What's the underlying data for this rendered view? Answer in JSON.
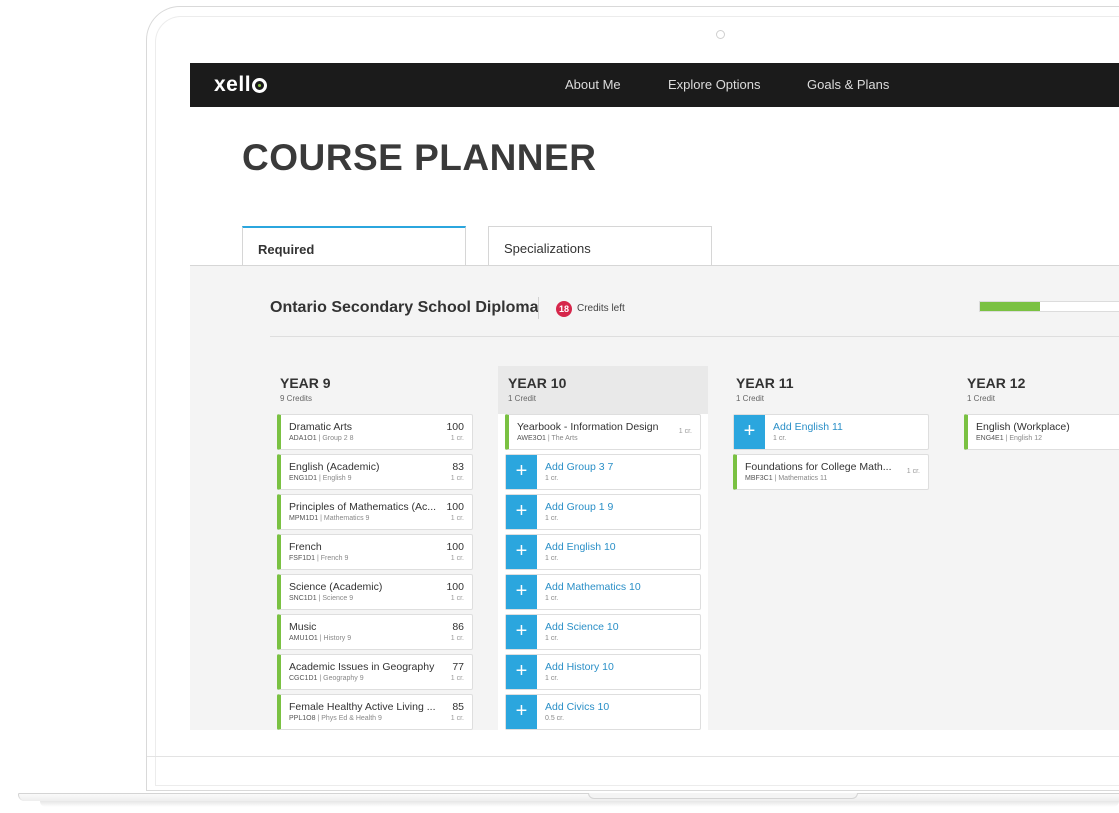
{
  "nav": {
    "logo": "xello",
    "items": [
      "About Me",
      "Explore Options",
      "Goals & Plans"
    ]
  },
  "page": {
    "title": "COURSE PLANNER"
  },
  "tabs": [
    {
      "label": "Required",
      "active": true
    },
    {
      "label": "Specializations",
      "active": false
    }
  ],
  "diploma": {
    "name": "Ontario Secondary School Diploma",
    "credits_left": "18",
    "credits_left_label": "Credits left",
    "progress_fraction": 0.43
  },
  "years": [
    {
      "title": "YEAR 9",
      "credits": "9 Credits",
      "courses": [
        {
          "type": "course",
          "title": "Dramatic Arts",
          "code": "ADA1O1",
          "group": "Group 2 8",
          "score": "100",
          "cr": "1 cr."
        },
        {
          "type": "course",
          "title": "English (Academic)",
          "code": "ENG1D1",
          "group": "English 9",
          "score": "83",
          "cr": "1 cr."
        },
        {
          "type": "course",
          "title": "Principles of Mathematics (Ac...",
          "code": "MPM1D1",
          "group": "Mathematics 9",
          "score": "100",
          "cr": "1 cr."
        },
        {
          "type": "course",
          "title": "French",
          "code": "FSF1D1",
          "group": "French 9",
          "score": "100",
          "cr": "1 cr."
        },
        {
          "type": "course",
          "title": "Science (Academic)",
          "code": "SNC1D1",
          "group": "Science 9",
          "score": "100",
          "cr": "1 cr."
        },
        {
          "type": "course",
          "title": "Music",
          "code": "AMU1O1",
          "group": "History 9",
          "score": "86",
          "cr": "1 cr."
        },
        {
          "type": "course",
          "title": "Academic Issues in Geography",
          "code": "CGC1D1",
          "group": "Geography 9",
          "score": "77",
          "cr": "1 cr."
        },
        {
          "type": "course",
          "title": "Female Healthy Active Living ...",
          "code": "PPL1O8",
          "group": "Phys Ed & Health 9",
          "score": "85",
          "cr": "1 cr."
        }
      ]
    },
    {
      "title": "YEAR 10",
      "credits": "1 Credit",
      "courses": [
        {
          "type": "course",
          "title": "Yearbook - Information Design",
          "code": "AWE3O1",
          "group": "The Arts",
          "score": "",
          "cr": "1 cr."
        },
        {
          "type": "add",
          "title": "Add Group 3 7",
          "cr": "1 cr."
        },
        {
          "type": "add",
          "title": "Add Group 1 9",
          "cr": "1 cr."
        },
        {
          "type": "add",
          "title": "Add English 10",
          "cr": "1 cr."
        },
        {
          "type": "add",
          "title": "Add Mathematics 10",
          "cr": "1 cr."
        },
        {
          "type": "add",
          "title": "Add Science 10",
          "cr": "1 cr."
        },
        {
          "type": "add",
          "title": "Add History 10",
          "cr": "1 cr."
        },
        {
          "type": "add",
          "title": "Add Civics 10",
          "cr": "0.5 cr."
        }
      ]
    },
    {
      "title": "YEAR 11",
      "credits": "1 Credit",
      "courses": [
        {
          "type": "add",
          "title": "Add English 11",
          "cr": "1 cr."
        },
        {
          "type": "course",
          "title": "Foundations for College Math...",
          "code": "MBF3C1",
          "group": "Mathematics 11",
          "score": "",
          "cr": "1 cr."
        }
      ]
    },
    {
      "title": "YEAR 12",
      "credits": "1 Credit",
      "courses": [
        {
          "type": "course",
          "title": "English (Workplace)",
          "code": "ENG4E1",
          "group": "English 12",
          "score": "",
          "cr": ""
        }
      ]
    }
  ],
  "colors": {
    "accent": "#2ba6de",
    "complete": "#7ac142",
    "badge": "#d6264b",
    "navbar": "#1b1b1b"
  }
}
